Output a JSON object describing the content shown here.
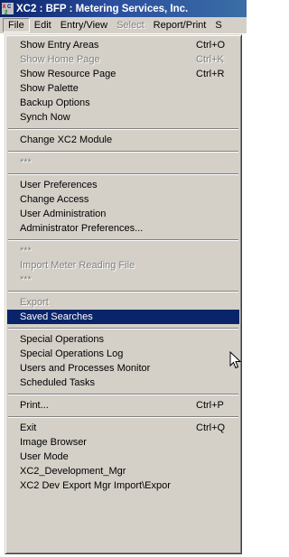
{
  "window": {
    "title": "XC2 : BFP : Metering Services, Inc.",
    "icon": "xc2-app-icon"
  },
  "menubar": [
    {
      "label": "File",
      "state": "active"
    },
    {
      "label": "Edit",
      "state": "normal"
    },
    {
      "label": "Entry/View",
      "state": "normal"
    },
    {
      "label": "Select",
      "state": "disabled"
    },
    {
      "label": "Report/Print",
      "state": "normal"
    },
    {
      "label": "S",
      "state": "normal"
    }
  ],
  "file_menu": [
    {
      "type": "item",
      "label": "Show Entry Areas",
      "shortcut": "Ctrl+O",
      "enabled": true
    },
    {
      "type": "item",
      "label": "Show Home Page",
      "shortcut": "Ctrl+K",
      "enabled": false
    },
    {
      "type": "item",
      "label": "Show Resource Page",
      "shortcut": "Ctrl+R",
      "enabled": true
    },
    {
      "type": "item",
      "label": "Show Palette",
      "shortcut": "",
      "enabled": true
    },
    {
      "type": "item",
      "label": "Backup Options",
      "shortcut": "",
      "enabled": true
    },
    {
      "type": "item",
      "label": "Synch Now",
      "shortcut": "",
      "enabled": true
    },
    {
      "type": "separator"
    },
    {
      "type": "item",
      "label": "Change XC2 Module",
      "shortcut": "",
      "enabled": true
    },
    {
      "type": "separator"
    },
    {
      "type": "item",
      "label": "***",
      "shortcut": "",
      "enabled": false
    },
    {
      "type": "separator"
    },
    {
      "type": "item",
      "label": "User Preferences",
      "shortcut": "",
      "enabled": true
    },
    {
      "type": "item",
      "label": "Change Access",
      "shortcut": "",
      "enabled": true
    },
    {
      "type": "item",
      "label": "User Administration",
      "shortcut": "",
      "enabled": true
    },
    {
      "type": "item",
      "label": "Administrator Preferences...",
      "shortcut": "",
      "enabled": true
    },
    {
      "type": "separator"
    },
    {
      "type": "item",
      "label": "***",
      "shortcut": "",
      "enabled": false
    },
    {
      "type": "item",
      "label": "Import Meter Reading File",
      "shortcut": "",
      "enabled": false
    },
    {
      "type": "item",
      "label": "***",
      "shortcut": "",
      "enabled": false
    },
    {
      "type": "separator"
    },
    {
      "type": "item",
      "label": "Export",
      "shortcut": "",
      "enabled": false
    },
    {
      "type": "item",
      "label": "Saved Searches",
      "shortcut": "",
      "enabled": true,
      "highlighted": true
    },
    {
      "type": "separator"
    },
    {
      "type": "item",
      "label": "Special Operations",
      "shortcut": "",
      "enabled": true
    },
    {
      "type": "item",
      "label": "Special Operations Log",
      "shortcut": "",
      "enabled": true
    },
    {
      "type": "item",
      "label": "Users and Processes Monitor",
      "shortcut": "",
      "enabled": true
    },
    {
      "type": "item",
      "label": "Scheduled Tasks",
      "shortcut": "",
      "enabled": true
    },
    {
      "type": "separator"
    },
    {
      "type": "item",
      "label": "Print...",
      "shortcut": "Ctrl+P",
      "enabled": true
    },
    {
      "type": "separator"
    },
    {
      "type": "item",
      "label": "Exit",
      "shortcut": "Ctrl+Q",
      "enabled": true
    },
    {
      "type": "item",
      "label": "Image Browser",
      "shortcut": "",
      "enabled": true
    },
    {
      "type": "item",
      "label": "User Mode",
      "shortcut": "",
      "enabled": true
    },
    {
      "type": "item",
      "label": "XC2_Development_Mgr",
      "shortcut": "",
      "enabled": true
    },
    {
      "type": "item",
      "label": "XC2 Dev Export Mgr Import\\Expor",
      "shortcut": "",
      "enabled": true
    }
  ],
  "colors": {
    "titlebar": "#0a246a",
    "menu_face": "#d4d0c8",
    "highlight": "#0a246a",
    "disabled_text": "#808080"
  },
  "cursor": "arrow-pointer-icon"
}
